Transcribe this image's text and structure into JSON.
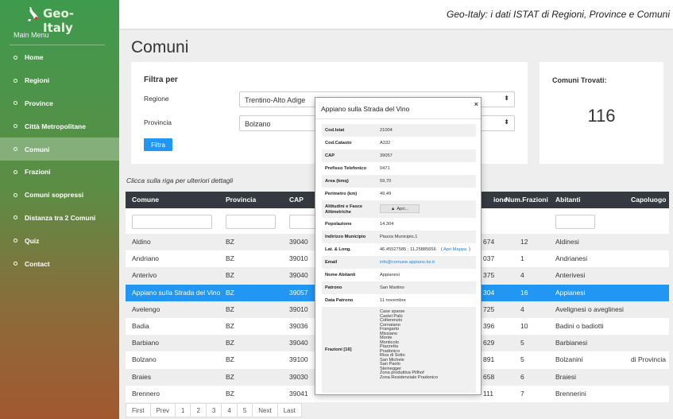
{
  "app": {
    "logo_text": "Geo-Italy",
    "header_title": "Geo-Italy: i dati ISTAT di Regioni, Province e Comuni"
  },
  "sidebar": {
    "title": "Main Menu",
    "items": [
      {
        "label": "Home"
      },
      {
        "label": "Regioni"
      },
      {
        "label": "Province"
      },
      {
        "label": "Città Metropolitane"
      },
      {
        "label": "Comuni",
        "active": true
      },
      {
        "label": "Frazioni"
      },
      {
        "label": "Comuni soppressi"
      },
      {
        "label": "Distanza tra 2 Comuni"
      },
      {
        "label": "Quiz"
      },
      {
        "label": "Contact"
      }
    ]
  },
  "page": {
    "title": "Comuni"
  },
  "filter": {
    "title": "Filtra per",
    "regione_label": "Regione",
    "regione_value": "Trentino-Alto Adige",
    "provincia_label": "Provincia",
    "provincia_value": "Bolzano",
    "button": "Filtra"
  },
  "count": {
    "title": "Comuni Trovati:",
    "value": "116"
  },
  "hint": "Clicca sulla riga per ulteriori dettagli",
  "table": {
    "columns": [
      "Comune",
      "Provincia",
      "CAP",
      "",
      "ione",
      "Num.Frazioni",
      "Abitanti",
      "Capoluogo"
    ],
    "rows": [
      {
        "comune": "Aldino",
        "prov": "BZ",
        "cap": "39040",
        "pop": "674",
        "fraz": "12",
        "abit": "Aldinesi",
        "capo": ""
      },
      {
        "comune": "Andriano",
        "prov": "BZ",
        "cap": "39010",
        "pop": "037",
        "fraz": "1",
        "abit": "Andrianesi",
        "capo": ""
      },
      {
        "comune": "Anterivo",
        "prov": "BZ",
        "cap": "39040",
        "pop": "375",
        "fraz": "4",
        "abit": "Anterivesi",
        "capo": ""
      },
      {
        "comune": "Appiano sulla Strada del Vino",
        "prov": "BZ",
        "cap": "39057",
        "pop": "304",
        "fraz": "16",
        "abit": "Appianesi",
        "capo": "",
        "selected": true
      },
      {
        "comune": "Avelengo",
        "prov": "BZ",
        "cap": "39010",
        "pop": "725",
        "fraz": "4",
        "abit": "Avelignesi o aveglinesi",
        "capo": ""
      },
      {
        "comune": "Badia",
        "prov": "BZ",
        "cap": "39036",
        "pop": "396",
        "fraz": "10",
        "abit": "Badini o badiotti",
        "capo": ""
      },
      {
        "comune": "Barbiano",
        "prov": "BZ",
        "cap": "39040",
        "pop": "629",
        "fraz": "5",
        "abit": "Barbianesi",
        "capo": ""
      },
      {
        "comune": "Bolzano",
        "prov": "BZ",
        "cap": "39100",
        "pop": "891",
        "fraz": "5",
        "abit": "Bolzanini",
        "capo": "di Provincia"
      },
      {
        "comune": "Braies",
        "prov": "BZ",
        "cap": "39030",
        "pop": "658",
        "fraz": "6",
        "abit": "Braiesi",
        "capo": ""
      },
      {
        "comune": "Brennero",
        "prov": "BZ",
        "cap": "39041",
        "pop": "111",
        "fraz": "7",
        "abit": "Brennerini",
        "capo": ""
      }
    ]
  },
  "pager": [
    "First",
    "Prev",
    "1",
    "2",
    "3",
    "4",
    "5",
    "Next",
    "Last"
  ],
  "modal": {
    "title": "Appiano sulla Strada del Vino",
    "close": "×",
    "rows": [
      {
        "k": "Cod.Istat",
        "v": "21004"
      },
      {
        "k": "Cod.Catasto",
        "v": "A332"
      },
      {
        "k": "CAP",
        "v": "39057"
      },
      {
        "k": "Prefisso Telefonico",
        "v": "0471"
      },
      {
        "k": "Area (kmq)",
        "v": "59,70"
      },
      {
        "k": "Perimetro (km)",
        "v": "49,49"
      },
      {
        "k": "Altitudini e Fasce Altimetriche",
        "v": "Apri..."
      },
      {
        "k": "Popolazione",
        "v": "14.304"
      },
      {
        "k": "Indirizzo Municipio",
        "v": "Piazza Municipio,1"
      },
      {
        "k": "Lat. & Long.",
        "v": "46,45527585 ; 11,25885656",
        "link": "Apri Mappa"
      },
      {
        "k": "Email",
        "v": "info@comune.appiano.bz.it"
      },
      {
        "k": "Nome Abitanti",
        "v": "Appianesi"
      },
      {
        "k": "Patrono",
        "v": "San Martino"
      },
      {
        "k": "Data Patrono",
        "v": "11 novembre"
      },
      {
        "k": "Frazioni [16]",
        "list": [
          "Case sparse",
          "Castel Palù",
          "Colterenzio",
          "Cornaiano",
          "Frangarto",
          "Missiano",
          "Monte",
          "Monticolo",
          "Piazzetta",
          "Pradonico",
          "Riva di Sotto",
          "San Michele",
          "San Paolo",
          "Steinegger",
          "Zona produttiva Pillhof",
          "Zona Residenziale Pradonico"
        ]
      }
    ]
  }
}
